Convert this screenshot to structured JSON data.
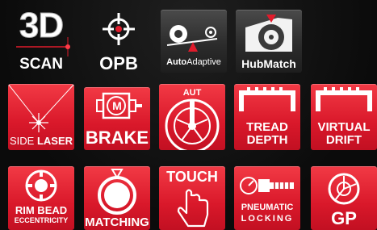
{
  "row1": {
    "scan": {
      "big": "3D",
      "label": "SCAN"
    },
    "opb": {
      "label": "OPB"
    },
    "autoadaptive": {
      "label_bold": "Auto",
      "label_rest": "Adaptive"
    },
    "hubmatch": {
      "label": "HubMatch"
    }
  },
  "row2": {
    "side_laser": {
      "label_a": "SIDE",
      "label_b": "LASER"
    },
    "brake": {
      "letter": "M",
      "label": "BRAKE"
    },
    "aut": {
      "label": "AUT"
    },
    "tread_depth": {
      "line1": "TREAD",
      "line2": "DEPTH"
    },
    "virtual_drift": {
      "line1": "VIRTUAL",
      "line2": "DRIFT"
    }
  },
  "row3": {
    "rim_bead": {
      "line1": "RIM BEAD",
      "line2": "ECCENTRICITY"
    },
    "matching": {
      "label": "MATCHING"
    },
    "touch": {
      "label": "TOUCH"
    },
    "pneumatic": {
      "line1": "PNEUMATIC",
      "line2": "LOCKING"
    },
    "gp": {
      "label": "GP"
    }
  },
  "colors": {
    "red": "#d9182a",
    "dark": "#333333",
    "white": "#ffffff"
  }
}
